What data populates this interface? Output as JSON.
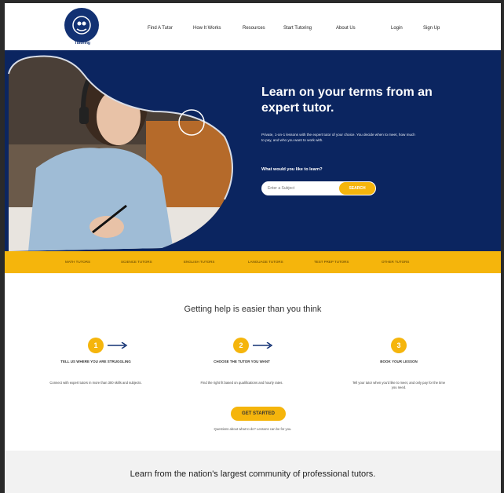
{
  "nav": {
    "logo_text": "Tutoring",
    "links": [
      "Find A Tutor",
      "How It Works",
      "Resources",
      "Start Tutoring",
      "About Us",
      "Login",
      "Sign Up"
    ]
  },
  "hero": {
    "title": "Learn on your terms from an expert tutor.",
    "description": "Private, 1-on-1 lessons with the expert tutor of your choice. You decide when to meet, how much to pay, and who you want to work with.",
    "question": "What would you like to learn?",
    "search_placeholder": "Enter a Subject",
    "search_button": "SEARCH"
  },
  "subjects": [
    "MATH TUTORS",
    "SCIENCE TUTORS",
    "ENGLISH TUTORS",
    "LANGUAGE TUTORS",
    "TEST PREP TUTORS",
    "OTHER TUTORS"
  ],
  "how": {
    "title": "Getting help is easier than you think",
    "steps": [
      {
        "num": "1",
        "title": "TELL US WHERE YOU ARE STRUGGLING",
        "desc": "Connect with expert tutors in more than 300 skills and subjects."
      },
      {
        "num": "2",
        "title": "CHOOSE THE TUTOR YOU WANT",
        "desc": "Find the right fit based on qualifications and hourly rates."
      },
      {
        "num": "3",
        "title": "BOOK YOUR LESSON",
        "desc": "Tell your tutor when you'd like to meet, and only pay for the time you need."
      }
    ],
    "cta": "GET STARTED",
    "cta_note": "Questions about what to do? Lessons can be for you."
  },
  "band": {
    "title": "Learn from the nation's largest community of professional tutors."
  },
  "colors": {
    "navy": "#0b2560",
    "accent": "#f5b50c"
  }
}
